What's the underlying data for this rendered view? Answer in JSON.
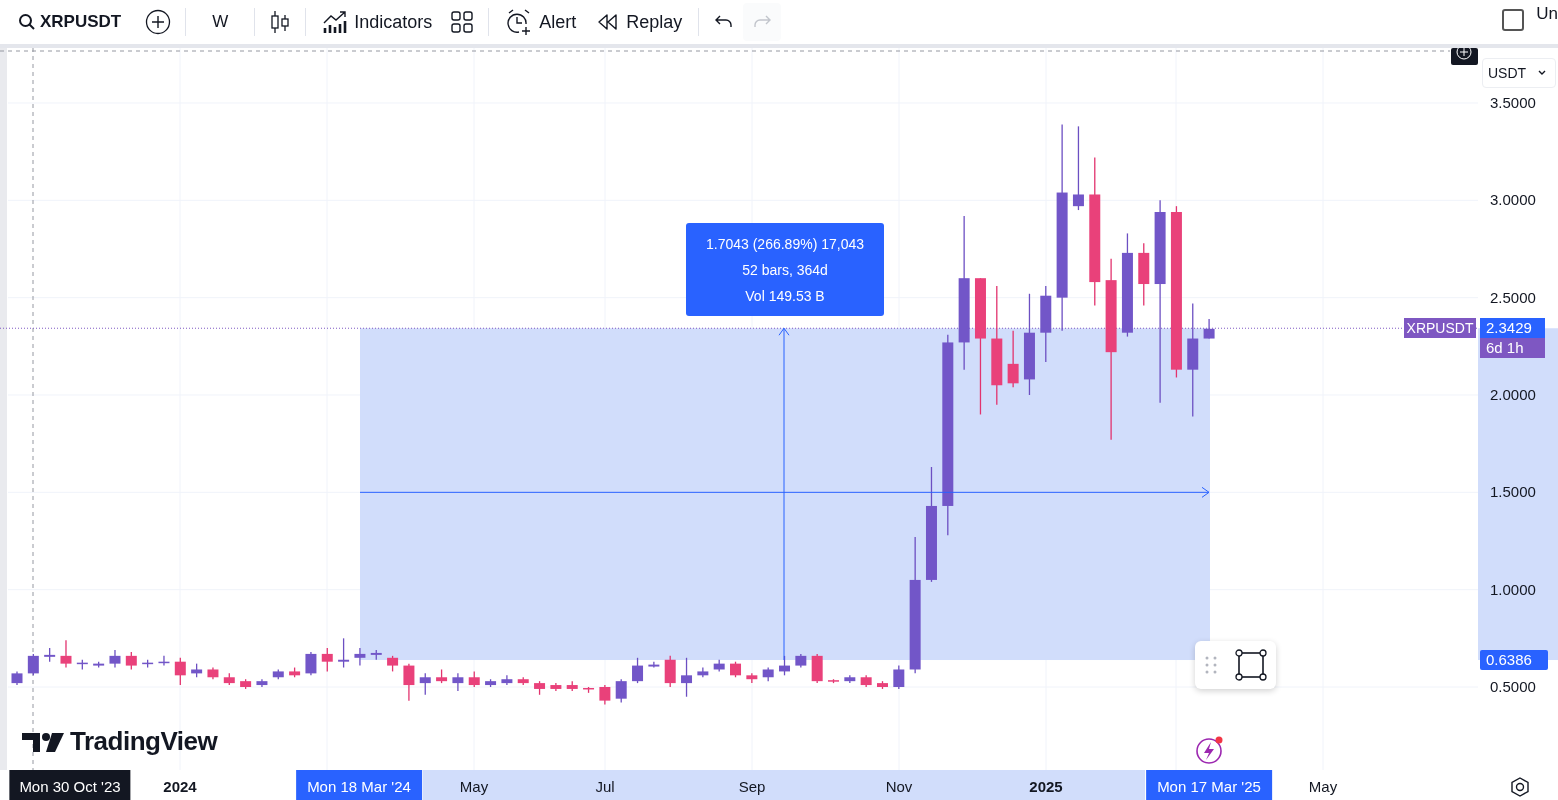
{
  "toolbar": {
    "items": [
      {
        "kind": "symbol",
        "label": "XRPUSDT"
      },
      {
        "kind": "add"
      },
      {
        "kind": "interval",
        "label": "W"
      },
      {
        "kind": "chart-type"
      },
      {
        "kind": "indicators",
        "label": "Indicators"
      },
      {
        "kind": "layouts"
      },
      {
        "kind": "alert",
        "label": "Alert"
      },
      {
        "kind": "replay",
        "label": "Replay"
      },
      {
        "kind": "undo",
        "disabled": false
      },
      {
        "kind": "redo",
        "disabled": true
      }
    ],
    "right": {
      "label": "Un",
      "checked": false
    }
  },
  "measure": {
    "lines": [
      "1.7043 (266.89%) 17,043",
      "52 bars, 364d",
      "Vol 149.53 B"
    ]
  },
  "logo": {
    "label": "TradingView"
  },
  "price_axis": {
    "currency": "USDT",
    "ticks": [
      "3.5000",
      "3.0000",
      "2.5000",
      "2.0000",
      "1.5000",
      "1.0000",
      "0.5000"
    ],
    "last_price": {
      "symbol": "XRPUSDT",
      "price": "2.3429",
      "countdown": "6d 1h"
    },
    "range_low": "0.6386"
  },
  "time_axis": {
    "labels": [
      {
        "kind": "crosshair",
        "text": "Mon 30 Oct '23",
        "bold": false
      },
      {
        "kind": "tick",
        "text": "2024",
        "bold": true
      },
      {
        "kind": "range",
        "text": "Mon 18 Mar '24",
        "bold": false
      },
      {
        "kind": "tick",
        "text": "May",
        "bold": false
      },
      {
        "kind": "tick",
        "text": "Jul",
        "bold": false
      },
      {
        "kind": "tick",
        "text": "Sep",
        "bold": false
      },
      {
        "kind": "tick",
        "text": "Nov",
        "bold": false
      },
      {
        "kind": "tick",
        "text": "2025",
        "bold": true
      },
      {
        "kind": "range",
        "text": "Mon 17 Mar '25",
        "bold": false
      },
      {
        "kind": "tick",
        "text": "May",
        "bold": false
      }
    ]
  }
}
